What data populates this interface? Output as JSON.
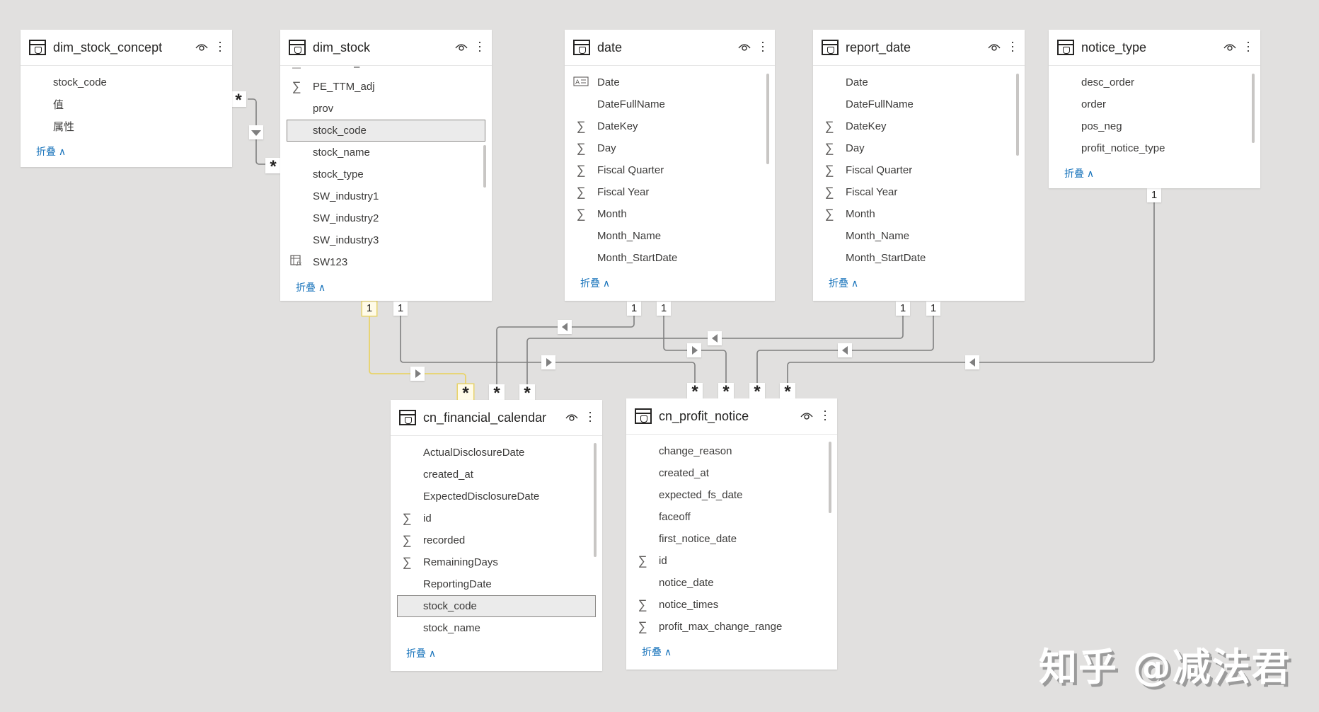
{
  "tables": {
    "dim_stock_concept": {
      "title": "dim_stock_concept",
      "fields": [
        {
          "name": "stock_code",
          "icon": ""
        },
        {
          "name": "值",
          "icon": ""
        },
        {
          "name": "属性",
          "icon": ""
        }
      ],
      "collapse_label": "折叠 ∧"
    },
    "dim_stock": {
      "title": "dim_stock",
      "partial_top_row": "–",
      "fields": [
        {
          "name": "PE_TTM_adj",
          "icon": "sigma-icon"
        },
        {
          "name": "prov",
          "icon": ""
        },
        {
          "name": "stock_code",
          "icon": "",
          "selected": true
        },
        {
          "name": "stock_name",
          "icon": ""
        },
        {
          "name": "stock_type",
          "icon": ""
        },
        {
          "name": "SW_industry1",
          "icon": ""
        },
        {
          "name": "SW_industry2",
          "icon": ""
        },
        {
          "name": "SW_industry3",
          "icon": ""
        },
        {
          "name": "SW123",
          "icon": "calculated-column-icon"
        }
      ],
      "collapse_label": "折叠 ∧"
    },
    "date": {
      "title": "date",
      "fields": [
        {
          "name": "Date",
          "icon": "hierarchy-icon"
        },
        {
          "name": "DateFullName",
          "icon": ""
        },
        {
          "name": "DateKey",
          "icon": "sigma-icon"
        },
        {
          "name": "Day",
          "icon": "sigma-icon"
        },
        {
          "name": "Fiscal Quarter",
          "icon": "sigma-icon"
        },
        {
          "name": "Fiscal Year",
          "icon": "sigma-icon"
        },
        {
          "name": "Month",
          "icon": "sigma-icon"
        },
        {
          "name": "Month_Name",
          "icon": ""
        },
        {
          "name": "Month_StartDate",
          "icon": ""
        }
      ],
      "collapse_label": "折叠 ∧"
    },
    "report_date": {
      "title": "report_date",
      "fields": [
        {
          "name": "Date",
          "icon": ""
        },
        {
          "name": "DateFullName",
          "icon": ""
        },
        {
          "name": "DateKey",
          "icon": "sigma-icon"
        },
        {
          "name": "Day",
          "icon": "sigma-icon"
        },
        {
          "name": "Fiscal Quarter",
          "icon": "sigma-icon"
        },
        {
          "name": "Fiscal Year",
          "icon": "sigma-icon"
        },
        {
          "name": "Month",
          "icon": "sigma-icon"
        },
        {
          "name": "Month_Name",
          "icon": ""
        },
        {
          "name": "Month_StartDate",
          "icon": ""
        }
      ],
      "collapse_label": "折叠 ∧"
    },
    "notice_type": {
      "title": "notice_type",
      "fields": [
        {
          "name": "desc_order",
          "icon": ""
        },
        {
          "name": "order",
          "icon": ""
        },
        {
          "name": "pos_neg",
          "icon": ""
        },
        {
          "name": "profit_notice_type",
          "icon": ""
        }
      ],
      "collapse_label": "折叠 ∧"
    },
    "cn_financial_calendar": {
      "title": "cn_financial_calendar",
      "fields": [
        {
          "name": "ActualDisclosureDate",
          "icon": ""
        },
        {
          "name": "created_at",
          "icon": ""
        },
        {
          "name": "ExpectedDisclosureDate",
          "icon": ""
        },
        {
          "name": "id",
          "icon": "sigma-icon"
        },
        {
          "name": "recorded",
          "icon": "sigma-icon"
        },
        {
          "name": "RemainingDays",
          "icon": "sigma-icon"
        },
        {
          "name": "ReportingDate",
          "icon": ""
        },
        {
          "name": "stock_code",
          "icon": "",
          "selected": true
        },
        {
          "name": "stock_name",
          "icon": ""
        }
      ],
      "collapse_label": "折叠 ∧"
    },
    "cn_profit_notice": {
      "title": "cn_profit_notice",
      "fields": [
        {
          "name": "change_reason",
          "icon": ""
        },
        {
          "name": "created_at",
          "icon": ""
        },
        {
          "name": "expected_fs_date",
          "icon": ""
        },
        {
          "name": "faceoff",
          "icon": ""
        },
        {
          "name": "first_notice_date",
          "icon": ""
        },
        {
          "name": "id",
          "icon": "sigma-icon"
        },
        {
          "name": "notice_date",
          "icon": ""
        },
        {
          "name": "notice_times",
          "icon": "sigma-icon"
        },
        {
          "name": "profit_max_change_range",
          "icon": "sigma-icon"
        }
      ],
      "collapse_label": "折叠 ∧"
    }
  },
  "relationships": [
    {
      "from": "dim_stock_concept",
      "to": "dim_stock",
      "from_card": "*",
      "to_card": "*",
      "direction": "down",
      "highlighted": false
    },
    {
      "from": "dim_stock",
      "to": "cn_financial_calendar",
      "from_card": "1",
      "to_card": "*",
      "direction": "right",
      "highlighted": true
    },
    {
      "from": "dim_stock",
      "to": "cn_profit_notice",
      "from_card": "1",
      "to_card": "*",
      "direction": "right",
      "highlighted": false
    },
    {
      "from": "date",
      "to": "cn_financial_calendar",
      "from_card": "1",
      "to_card": "*",
      "direction": "left",
      "highlighted": false
    },
    {
      "from": "date",
      "to": "cn_profit_notice",
      "from_card": "1",
      "to_card": "*",
      "direction": "right",
      "highlighted": false
    },
    {
      "from": "report_date",
      "to": "cn_financial_calendar",
      "from_card": "1",
      "to_card": "*",
      "direction": "left",
      "highlighted": false
    },
    {
      "from": "report_date",
      "to": "cn_profit_notice",
      "from_card": "1",
      "to_card": "*",
      "direction": "left",
      "highlighted": false
    },
    {
      "from": "notice_type",
      "to": "cn_profit_notice",
      "from_card": "1",
      "to_card": "*",
      "direction": "left",
      "highlighted": false
    }
  ],
  "watermark": "知乎 @减法君",
  "colors": {
    "canvas": "#e1e0df",
    "line": "#7f7f7f",
    "highlight_line": "#e8d36a",
    "link": "#1b75bc"
  }
}
